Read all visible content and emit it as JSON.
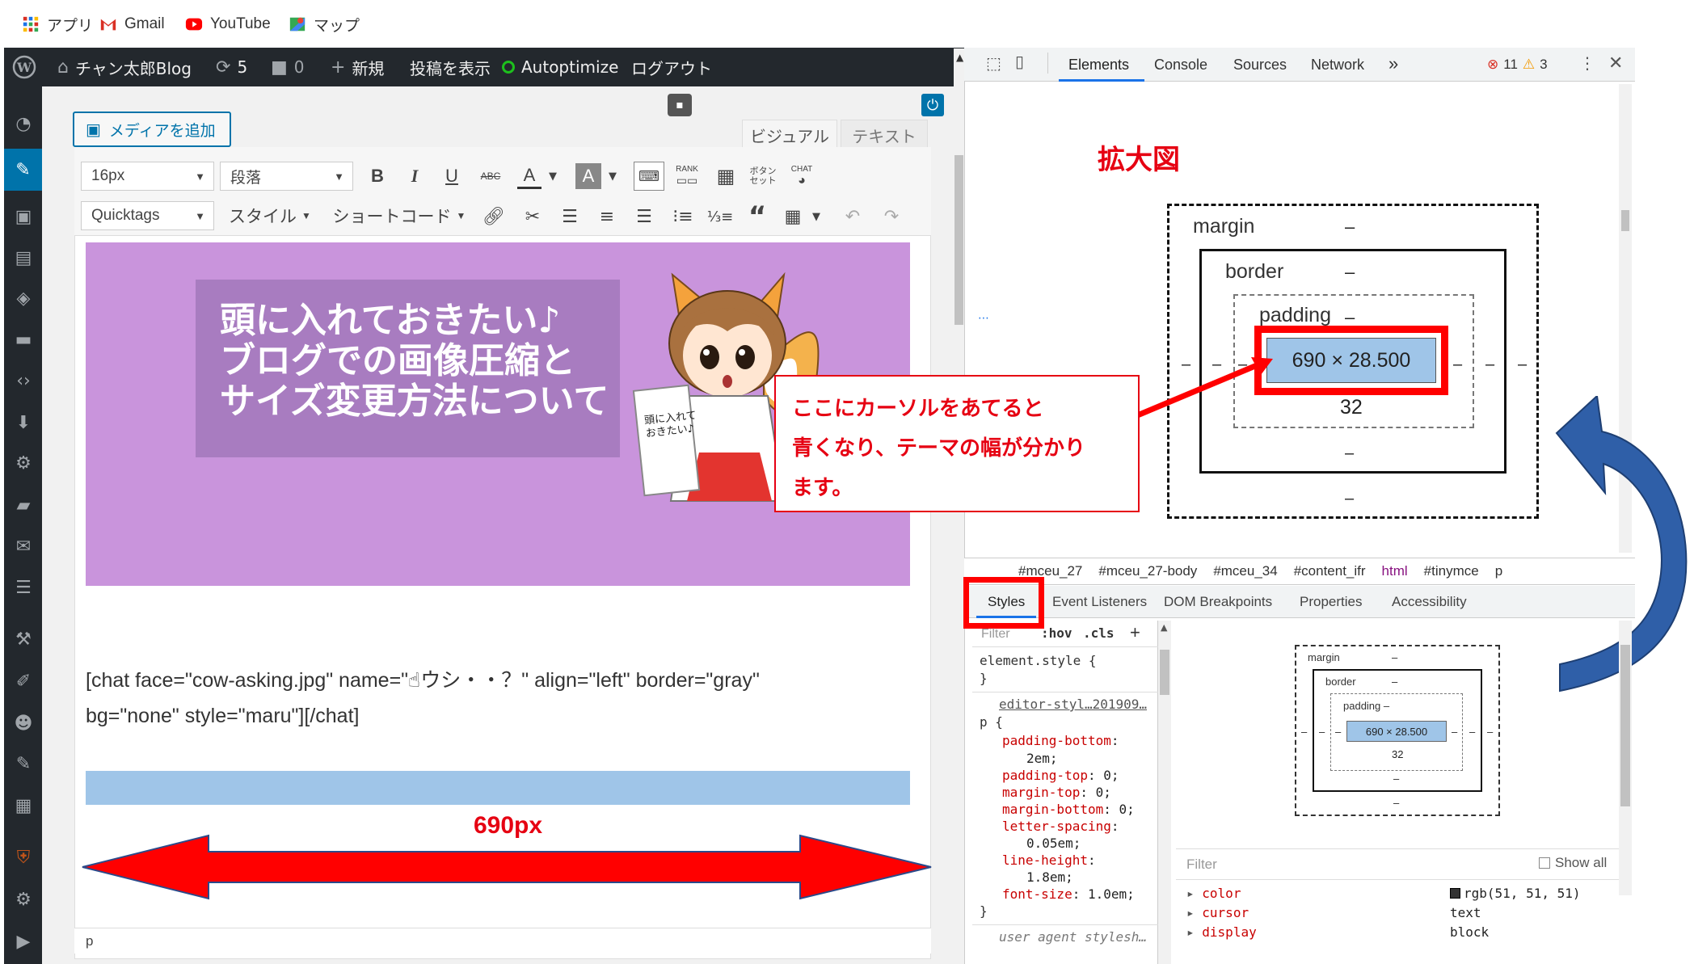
{
  "bookmarks": {
    "apps": "アプリ",
    "gmail": "Gmail",
    "youtube": "YouTube",
    "maps": "マップ"
  },
  "adminbar": {
    "site": "チャン太郎Blog",
    "updates": "5",
    "comments": "0",
    "new": "新規",
    "view_post": "投稿を表示",
    "autoptimize": "Autoptimize",
    "logout": "ログアウト"
  },
  "editor": {
    "add_media": "メディアを追加",
    "tab_visual": "ビジュアル",
    "tab_text": "テキスト",
    "font_size": "16px",
    "paragraph": "段落",
    "quicktags": "Quicktags",
    "style": "スタイル",
    "shortcode": "ショートコード",
    "tb_rank": "RANK",
    "tb_button": "ボタン セット",
    "tb_chat": "CHAT",
    "banner_title_1": "頭に入れておきたい♪",
    "banner_title_2": "ブログでの画像圧縮と",
    "banner_title_3": "サイズ変更方法について",
    "sign_text": "頭に入れて おきたい♪",
    "shortcode_line1": "[chat face=\"cow-asking.jpg\" name=\"☝ウシ・・？\" align=\"left\" border=\"gray\"",
    "shortcode_line2": "bg=\"none\" style=\"maru\"][/chat]",
    "width_label": "690px",
    "status_path": "p"
  },
  "devtools": {
    "tabs": [
      "Elements",
      "Console",
      "Sources",
      "Network"
    ],
    "more": "»",
    "errors": "11",
    "warnings": "3",
    "zoom_label": "拡大図",
    "box_big": {
      "margin": "margin",
      "border": "border",
      "padding": "padding",
      "dash": "–",
      "content": "690 × 28.500",
      "padding_bottom": "32"
    },
    "callout_1": "ここにカーソルをあてると",
    "callout_2": "青くなり、テーマの幅が分かり",
    "callout_3": "ます。",
    "breadcrumbs": [
      "#mceu_27",
      "#mceu_27-body",
      "#mceu_34",
      "#content_ifr",
      "html",
      "#tinymce",
      "p"
    ],
    "subtabs": [
      "Styles",
      "Event Listeners",
      "DOM Breakpoints",
      "Properties",
      "Accessibility"
    ],
    "filter": "Filter",
    "hov": ":hov",
    "cls": ".cls",
    "plus": "+",
    "element_style": "element.style {",
    "close_brace": "}",
    "source_link": "editor-styl…201909…",
    "p_selector": "p {",
    "css": [
      {
        "prop": "padding-bottom",
        "val": "2em;"
      },
      {
        "prop": "padding-top",
        "val": "0;"
      },
      {
        "prop": "margin-top",
        "val": "0;"
      },
      {
        "prop": "margin-bottom",
        "val": "0;"
      },
      {
        "prop": "letter-spacing",
        "val": "0.05em;"
      },
      {
        "prop": "line-height",
        "val": "1.8em;"
      },
      {
        "prop": "font-size",
        "val": "1.0em;"
      }
    ],
    "user_agent": "user agent stylesh…",
    "computed_filter": "Filter",
    "show_all": "Show all",
    "computed": [
      {
        "prop": "color",
        "val": "rgb(51, 51, 51)"
      },
      {
        "prop": "cursor",
        "val": "text"
      },
      {
        "prop": "display",
        "val": "block"
      }
    ]
  },
  "colors": {
    "admin_bar": "#23282d",
    "banner_bg": "#c994dc",
    "banner_box": "#a87cc0",
    "accent_red": "#e60012",
    "box_content": "#9fc5e8",
    "devtools_blue": "#1a73e8",
    "arrow_blue": "#2f5fa8"
  }
}
